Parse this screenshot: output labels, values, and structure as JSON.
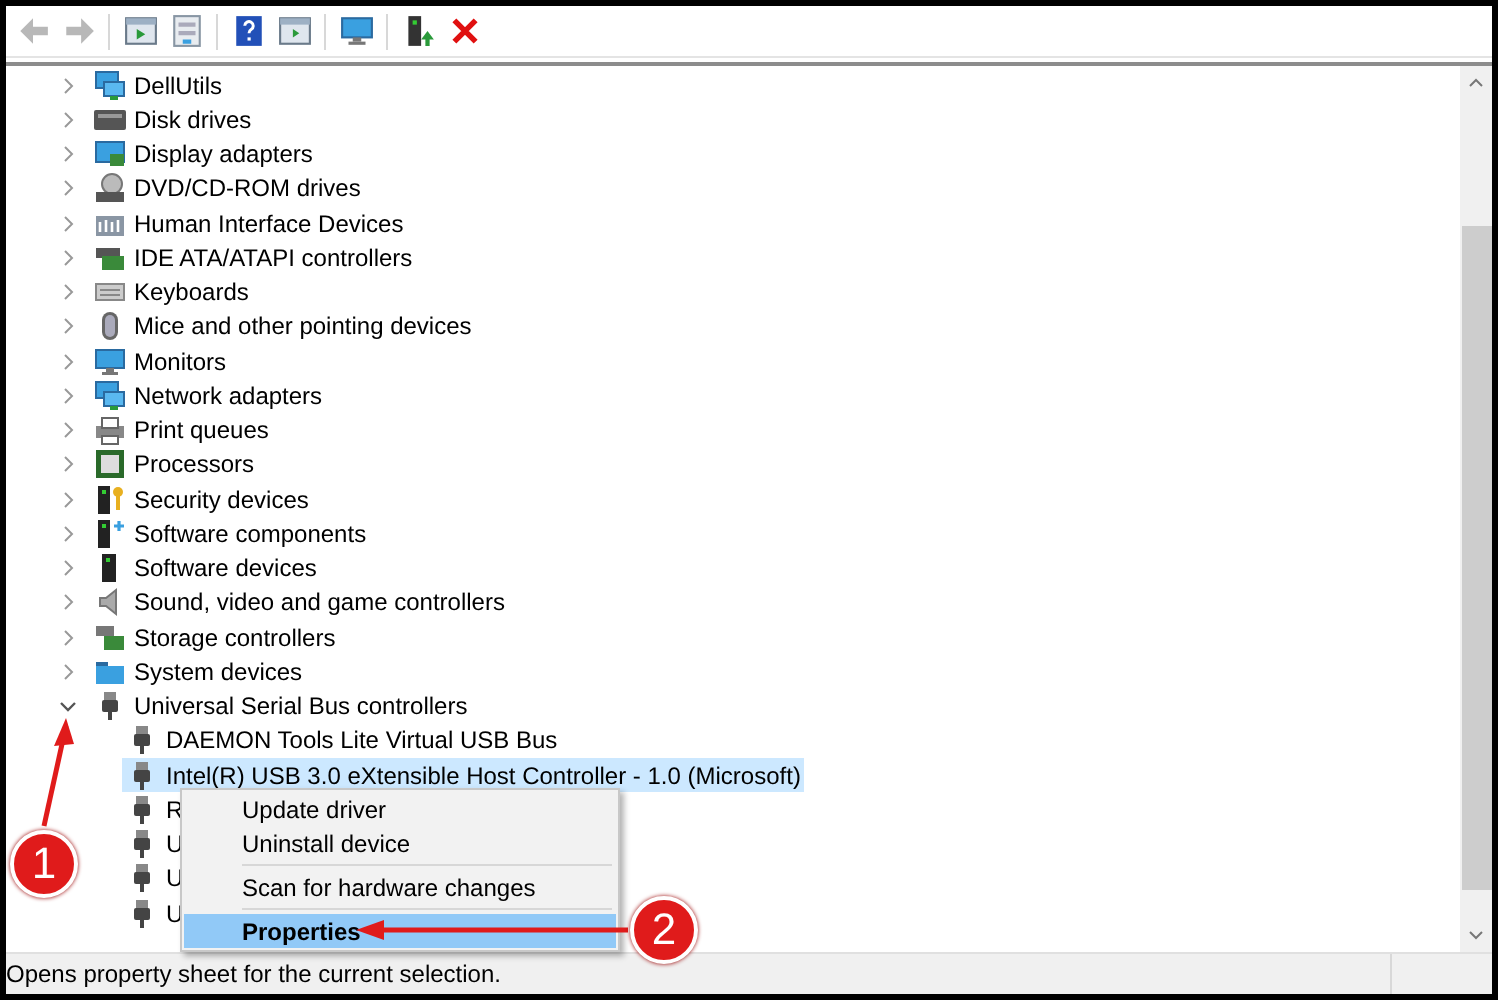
{
  "toolbar": {
    "buttons": [
      {
        "kind": "back",
        "disabled": true
      },
      {
        "kind": "forward",
        "disabled": true
      },
      {
        "kind": "window",
        "disabled": false
      },
      {
        "kind": "sheet",
        "disabled": false
      },
      {
        "kind": "help",
        "disabled": false
      },
      {
        "kind": "run",
        "disabled": false
      },
      {
        "kind": "monitor",
        "disabled": false
      },
      {
        "kind": "driver",
        "disabled": false
      },
      {
        "kind": "remove",
        "disabled": false
      }
    ]
  },
  "tree": {
    "items": [
      {
        "label": "DellUtils",
        "kind": "network",
        "expanded": false
      },
      {
        "label": "Disk drives",
        "kind": "drive",
        "expanded": false
      },
      {
        "label": "Display adapters",
        "kind": "display",
        "expanded": false
      },
      {
        "label": "DVD/CD-ROM drives",
        "kind": "disc",
        "expanded": false
      },
      {
        "label": "Human Interface Devices",
        "kind": "hid",
        "expanded": false
      },
      {
        "label": "IDE ATA/ATAPI controllers",
        "kind": "controller",
        "expanded": false
      },
      {
        "label": "Keyboards",
        "kind": "keyboard",
        "expanded": false
      },
      {
        "label": "Mice and other pointing devices",
        "kind": "mouse",
        "expanded": false
      },
      {
        "label": "Monitors",
        "kind": "monitor",
        "expanded": false
      },
      {
        "label": "Network adapters",
        "kind": "network",
        "expanded": false
      },
      {
        "label": "Print queues",
        "kind": "printer",
        "expanded": false
      },
      {
        "label": "Processors",
        "kind": "chip",
        "expanded": false
      },
      {
        "label": "Security devices",
        "kind": "security",
        "expanded": false
      },
      {
        "label": "Software components",
        "kind": "software",
        "expanded": false
      },
      {
        "label": "Software devices",
        "kind": "tower",
        "expanded": false
      },
      {
        "label": "Sound, video and game controllers",
        "kind": "speaker",
        "expanded": false
      },
      {
        "label": "Storage controllers",
        "kind": "storage",
        "expanded": false
      },
      {
        "label": "System devices",
        "kind": "folder",
        "expanded": false
      },
      {
        "label": "Universal Serial Bus controllers",
        "kind": "usb",
        "expanded": true,
        "children": [
          {
            "label": "DAEMON Tools Lite Virtual USB Bus",
            "kind": "usb",
            "selected": false
          },
          {
            "label": "Intel(R) USB 3.0 eXtensible Host Controller - 1.0 (Microsoft)",
            "kind": "usb",
            "selected": true
          },
          {
            "label": "R",
            "kind": "usb",
            "selected": false
          },
          {
            "label": "U",
            "kind": "usb",
            "selected": false
          },
          {
            "label": "U",
            "kind": "usb",
            "selected": false
          },
          {
            "label": "U",
            "kind": "usb",
            "selected": false
          }
        ]
      }
    ]
  },
  "context_menu": {
    "items": [
      {
        "kind": "item",
        "label": "Update driver",
        "selected": false
      },
      {
        "kind": "item",
        "label": "Uninstall device",
        "selected": false
      },
      {
        "kind": "separator"
      },
      {
        "kind": "item",
        "label": "Scan for hardware changes",
        "selected": false
      },
      {
        "kind": "separator"
      },
      {
        "kind": "item",
        "label": "Properties",
        "selected": true
      }
    ]
  },
  "status_bar": {
    "text": "Opens property sheet for the current selection."
  },
  "annotations": [
    {
      "label": "1",
      "kind": "up"
    },
    {
      "label": "2",
      "kind": "left"
    }
  ]
}
